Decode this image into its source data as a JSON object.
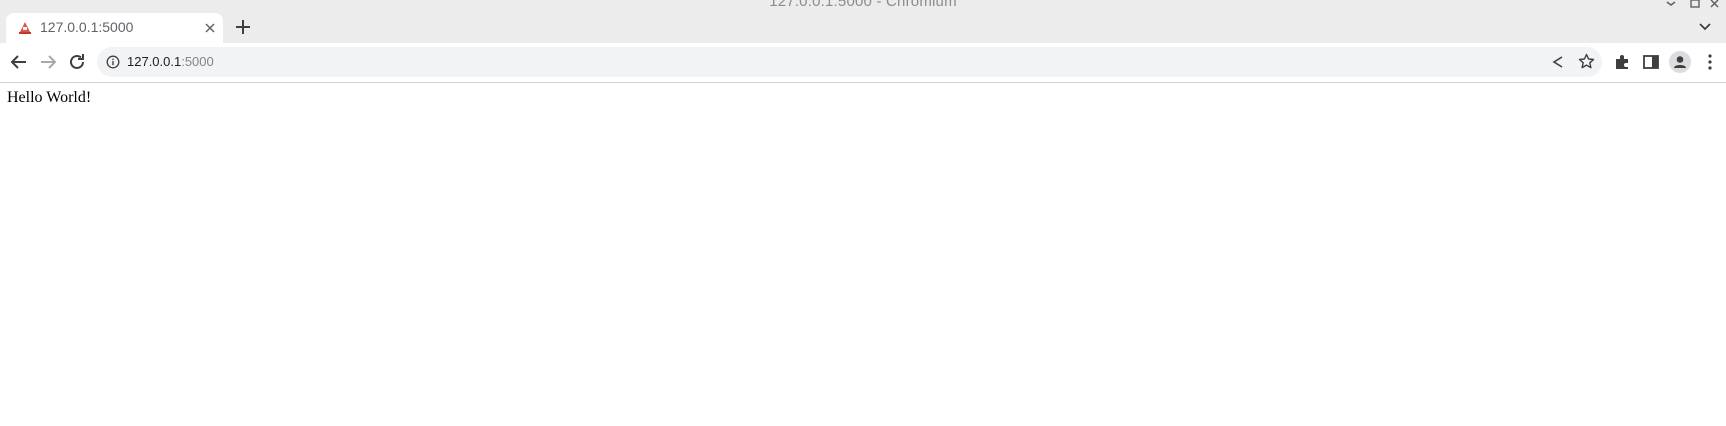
{
  "window": {
    "title": "127.0.0.1:5000 - Chromium"
  },
  "tabs": [
    {
      "title": "127.0.0.1:5000",
      "active": true
    }
  ],
  "toolbar": {
    "url_host": "127.0.0.1",
    "url_port": ":5000"
  },
  "page": {
    "body_text": "Hello World!"
  },
  "icons": {
    "favicon": "tab-favicon-icon",
    "tab_close": "close-icon",
    "new_tab": "plus-icon",
    "tab_search": "chevron-down-icon",
    "back": "arrow-left-icon",
    "forward": "arrow-right-icon",
    "reload": "reload-icon",
    "site_info": "info-icon",
    "share": "share-icon",
    "bookmark": "star-icon",
    "extensions": "puzzle-icon",
    "side_panel": "side-panel-icon",
    "profile": "person-icon",
    "menu": "kebab-menu-icon"
  },
  "colors": {
    "titlebar_bg": "#ececec",
    "omnibox_bg": "#f1f3f4",
    "icon": "#3c4043",
    "disabled_icon": "#a7a9ac"
  }
}
